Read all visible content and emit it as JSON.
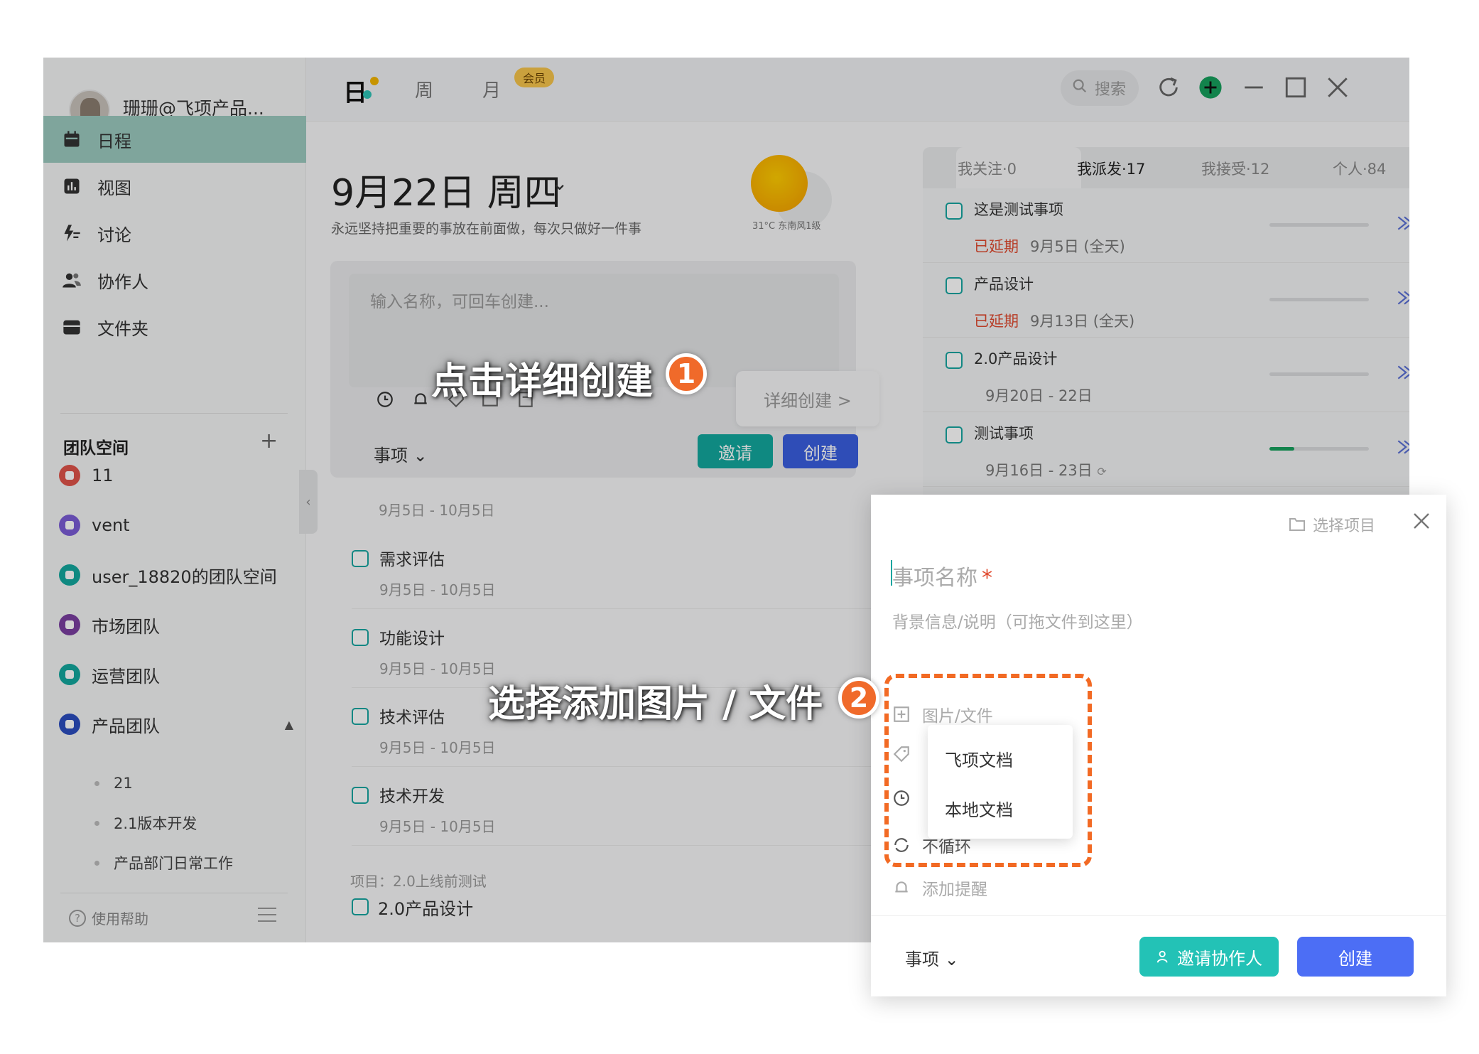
{
  "sidebar": {
    "username": "珊珊@飞项产品...",
    "nav": [
      {
        "label": "日程",
        "icon": "calendar-icon",
        "active": true
      },
      {
        "label": "视图",
        "icon": "chart-icon"
      },
      {
        "label": "讨论",
        "icon": "discussion-icon"
      },
      {
        "label": "协作人",
        "icon": "people-icon"
      },
      {
        "label": "文件夹",
        "icon": "folder-icon"
      }
    ],
    "team_title": "团队空间",
    "teams": [
      {
        "label": "11",
        "color": "#e0544a"
      },
      {
        "label": "vent",
        "color": "#7b5cd6"
      },
      {
        "label": "user_18820的团队空间",
        "color": "#13a89e"
      },
      {
        "label": "市场团队",
        "color": "#7b3fa0"
      },
      {
        "label": "运营团队",
        "color": "#13a89e"
      },
      {
        "label": "产品团队",
        "color": "#2b4dbf"
      }
    ],
    "sub_items": [
      "21",
      "2.1版本开发",
      "产品部门日常工作"
    ],
    "help_label": "使用帮助"
  },
  "topbar": {
    "tab_day": "日",
    "tab_week": "周",
    "tab_month": "月",
    "vip_badge": "会员",
    "search_placeholder": "搜索"
  },
  "header": {
    "date": "9月22日 周四",
    "motto": "永远坚持把重要的事放在前面做，每次只做好一件事",
    "weather": "31°C 东南风1级"
  },
  "quick_create": {
    "placeholder": "输入名称，可回车创建...",
    "type": "事项",
    "invite_label": "邀请",
    "create_label": "创建",
    "detail_label": "详细创建 >"
  },
  "tasks": {
    "first_date": "9月5日 - 10月5日",
    "items": [
      {
        "name": "需求评估",
        "date": "9月5日 - 10月5日"
      },
      {
        "name": "功能设计",
        "date": "9月5日 - 10月5日"
      },
      {
        "name": "技术评估",
        "date": "9月5日 - 10月5日"
      },
      {
        "name": "技术开发",
        "date": "9月5日 - 10月5日"
      }
    ],
    "project_label": "项目：2.0上线前测试",
    "last_task": "2.0产品设计"
  },
  "right_panel": {
    "tabs": [
      "我关注·0",
      "我派发·17",
      "我接受·12",
      "个人·84"
    ],
    "active_tab": 1,
    "tasks": [
      {
        "name": "这是测试事项",
        "delay": "已延期",
        "date": "9月5日 (全天)",
        "progress": 0
      },
      {
        "name": "产品设计",
        "delay": "已延期",
        "date": "9月13日 (全天)",
        "progress": 0
      },
      {
        "name": "2.0产品设计",
        "delay": "",
        "date": "9月20日 - 22日",
        "progress": 0
      },
      {
        "name": "测试事项",
        "delay": "",
        "date": "9月16日 - 23日",
        "progress": 0.25
      }
    ]
  },
  "dialog": {
    "select_project": "选择项目",
    "name_placeholder": "事项名称",
    "required_mark": "*",
    "desc_placeholder": "背景信息/说明（可拖文件到这里）",
    "attach_label": "图片/文件",
    "repeat_label": "不循环",
    "reminder_label": "添加提醒",
    "type": "事项",
    "invite_collab_label": "邀请协作人",
    "create_label": "创建",
    "dropdown": [
      "飞项文档",
      "本地文档"
    ]
  },
  "annotations": {
    "step1_text": "点击详细创建",
    "step1_num": "1",
    "step2_text": "选择添加图片 / 文件",
    "step2_num": "2"
  }
}
